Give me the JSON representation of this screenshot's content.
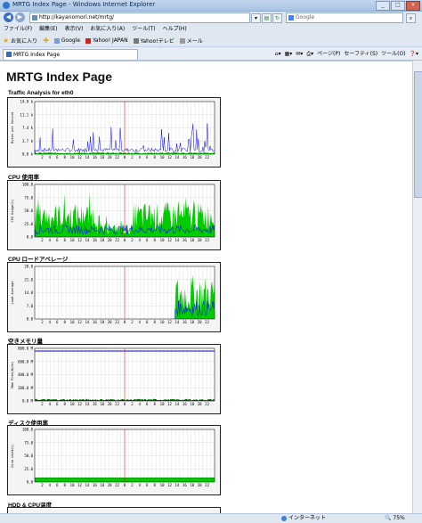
{
  "window": {
    "title": "MRTG Index Page - Windows Internet Explorer",
    "buttons": [
      "_",
      "□",
      "×"
    ]
  },
  "address": {
    "url": "http://kayanomori.net/mrtg/",
    "search_placeholder": "Google"
  },
  "menubar": [
    "ファイル(F)",
    "編集(E)",
    "表示(V)",
    "お気に入り(A)",
    "ツール(T)",
    "ヘルプ(H)"
  ],
  "favorites_bar": {
    "label": "お気に入り",
    "items": [
      "Google",
      "Yahoo! JAPAN",
      "Yahoo!テレビ",
      "メール"
    ]
  },
  "tab": {
    "title": "MRTG Index Page"
  },
  "command_bar": [
    "ページ(P)",
    "セーフティ(S)",
    "ツール(O)"
  ],
  "page": {
    "heading": "MRTG Index Page"
  },
  "sections": [
    {
      "title": "Traffic Analysis for eth0",
      "ylabel": "Bytes per Second",
      "yticks": [
        "14.8 k",
        "11.1 k",
        "7.4 k",
        "3.7 k",
        "0.0 k"
      ]
    },
    {
      "title": "CPU 使用率",
      "ylabel": "CPU Usage(%)",
      "yticks": [
        "100.0",
        "75.0",
        "50.0",
        "25.0",
        "0.0"
      ]
    },
    {
      "title": "CPU ロードアベレージ",
      "ylabel": "Load Average",
      "yticks": [
        "28.0",
        "21.0",
        "14.0",
        "7.0",
        "0.0"
      ]
    },
    {
      "title": "空きメモリ量",
      "ylabel": "Mem Free(Byte)",
      "yticks": [
        "800.0 M",
        "600.0 M",
        "400.0 M",
        "200.0 M",
        "0.0 M"
      ]
    },
    {
      "title": "ディスク使用率",
      "ylabel": "Disk Used(%)",
      "yticks": [
        "100.0",
        "75.0",
        "50.0",
        "25.0",
        "0.0"
      ]
    },
    {
      "title": "HDD & CPU温度"
    }
  ],
  "xticks": [
    "2",
    "4",
    "6",
    "8",
    "10",
    "12",
    "14",
    "16",
    "18",
    "20",
    "22",
    "0",
    "2",
    "4",
    "6",
    "8",
    "10",
    "12",
    "14",
    "16",
    "18",
    "20",
    "22"
  ],
  "colors": {
    "blue": "#0000ff",
    "green": "#00cc00",
    "darkgreen": "#006600",
    "red": "#ff0000"
  },
  "status": {
    "zone": "インターネット",
    "zoom": "75%"
  }
}
